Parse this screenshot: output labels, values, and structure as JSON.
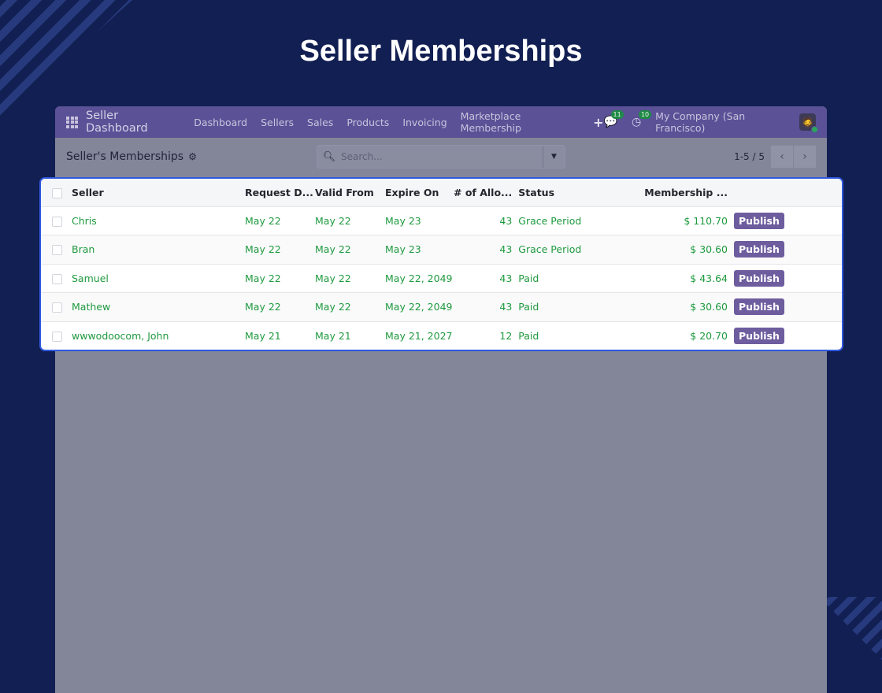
{
  "hero_title": "Seller Memberships",
  "navbar": {
    "brand": "Seller Dashboard",
    "menu": [
      "Dashboard",
      "Sellers",
      "Sales",
      "Products",
      "Invoicing",
      "Marketplace Membership"
    ],
    "plus": "+",
    "messages_count": "11",
    "activities_count": "10",
    "company": "My Company (San Francisco)"
  },
  "control_panel": {
    "title": "Seller's Memberships",
    "search_placeholder": "Search...",
    "pager": "1-5 / 5"
  },
  "table": {
    "columns": [
      "Seller",
      "Request D...",
      "Valid From",
      "Expire On",
      "# of Allo...",
      "Status",
      "Membership ..."
    ],
    "rows": [
      {
        "seller": "Chris",
        "request_date": "May 22",
        "valid_from": "May 22",
        "expire_on": "May 23",
        "allowed": "43",
        "status": "Grace Period",
        "price": "$ 110.70",
        "action": "Publish"
      },
      {
        "seller": "Bran",
        "request_date": "May 22",
        "valid_from": "May 22",
        "expire_on": "May 23",
        "allowed": "43",
        "status": "Grace Period",
        "price": "$ 30.60",
        "action": "Publish"
      },
      {
        "seller": "Samuel",
        "request_date": "May 22",
        "valid_from": "May 22",
        "expire_on": "May 22, 2049",
        "allowed": "43",
        "status": "Paid",
        "price": "$ 43.64",
        "action": "Publish"
      },
      {
        "seller": "Mathew",
        "request_date": "May 22",
        "valid_from": "May 22",
        "expire_on": "May 22, 2049",
        "allowed": "43",
        "status": "Paid",
        "price": "$ 30.60",
        "action": "Publish"
      },
      {
        "seller": "wwwodoocom, John",
        "request_date": "May 21",
        "valid_from": "May 21",
        "expire_on": "May 21, 2027",
        "allowed": "12",
        "status": "Paid",
        "price": "$ 20.70",
        "action": "Publish"
      }
    ]
  },
  "colors": {
    "background": "#121f52",
    "navbar": "#5b5197",
    "row_text": "#1f9a3f",
    "publish_button": "#6e5d9e",
    "highlight_border": "#2f59e0"
  }
}
